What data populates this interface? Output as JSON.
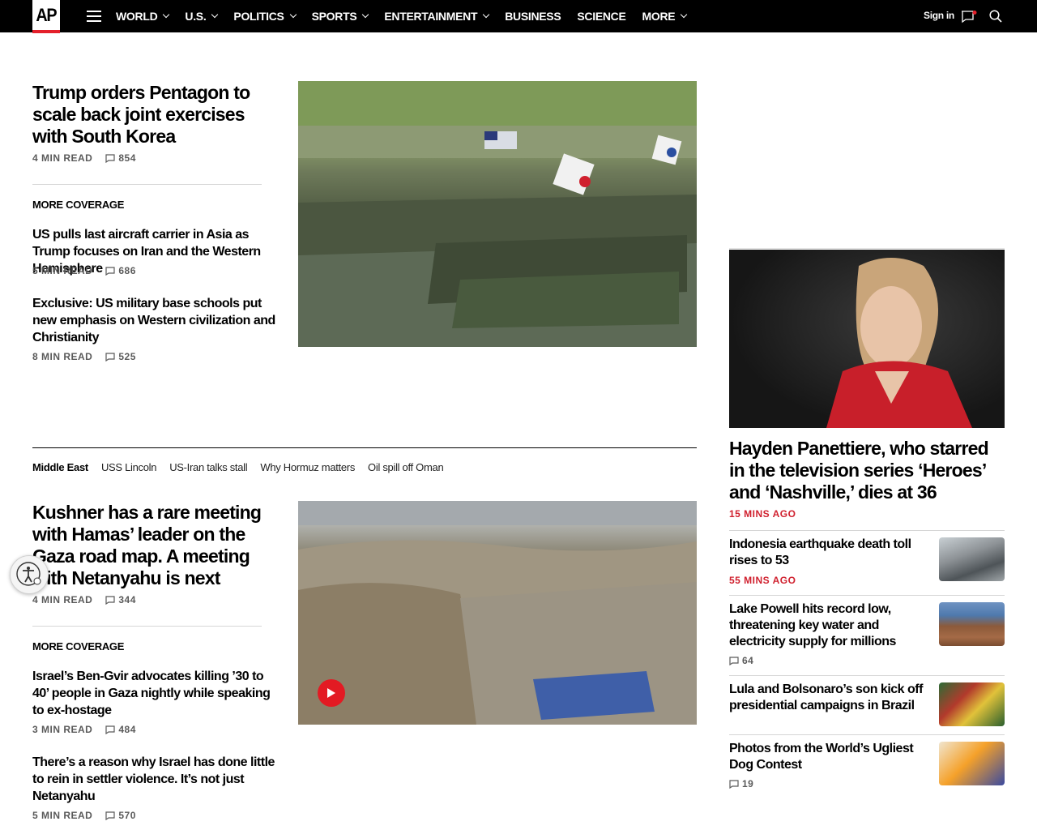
{
  "header": {
    "logo": "AP",
    "nav": [
      {
        "label": "WORLD",
        "chevron": true
      },
      {
        "label": "U.S.",
        "chevron": true
      },
      {
        "label": "POLITICS",
        "chevron": true
      },
      {
        "label": "SPORTS",
        "chevron": true
      },
      {
        "label": "ENTERTAINMENT",
        "chevron": true
      },
      {
        "label": "BUSINESS",
        "chevron": false
      },
      {
        "label": "SCIENCE",
        "chevron": false
      },
      {
        "label": "MORE",
        "chevron": true
      }
    ],
    "signin": "Sign in",
    "icons": [
      "menu-icon",
      "notification-icon",
      "search-icon"
    ],
    "accent": "#e4202b"
  },
  "lead": {
    "headline": "Trump orders Pentagon to scale back joint exercises with South Korea",
    "read": "4 MIN READ",
    "comments": "854",
    "more_coverage": "MORE COVERAGE",
    "related": [
      {
        "headline": "US pulls last aircraft carrier in Asia as Trump focuses on Iran and the Western Hemisphere",
        "read": "5 MIN READ",
        "comments": "686"
      },
      {
        "headline": "Exclusive: US military base schools put new emphasis on Western civilization and Christianity",
        "read": "8 MIN READ",
        "comments": "525"
      }
    ]
  },
  "topics": [
    "Middle East",
    "USS Lincoln",
    "US-Iran talks stall",
    "Why Hormuz matters",
    "Oil spill off Oman"
  ],
  "second": {
    "headline": "Kushner has a rare meeting with Hamas’ leader on the Gaza road map. A meeting with Netanyahu is next",
    "read": "4 MIN READ",
    "comments": "344",
    "more_coverage": "MORE COVERAGE",
    "related": [
      {
        "headline": "Israel’s Ben-Gvir advocates killing ’30 to 40’ people in Gaza nightly while speaking to ex-hostage",
        "read": "3 MIN READ",
        "comments": "484"
      },
      {
        "headline": "There’s a reason why Israel has done little to rein in settler violence. It’s not just Netanyahu",
        "read": "5 MIN READ",
        "comments": "570"
      }
    ]
  },
  "sidebar": {
    "feature": {
      "headline": "Hayden Panettiere, who starred in the television series ‘Heroes’ and ‘Nashville,’ dies at 36",
      "time": "15 MINS AGO"
    },
    "items": [
      {
        "headline": "Indonesia earthquake death toll rises to 53",
        "time": "55 MINS AGO"
      },
      {
        "headline": "Lake Powell hits record low, threatening key water and electricity supply for millions",
        "comments": "64"
      },
      {
        "headline": "Lula and Bolsonaro’s son kick off presidential campaigns in Brazil"
      },
      {
        "headline": "Photos from the World’s Ugliest Dog Contest",
        "comments": "19"
      }
    ]
  }
}
